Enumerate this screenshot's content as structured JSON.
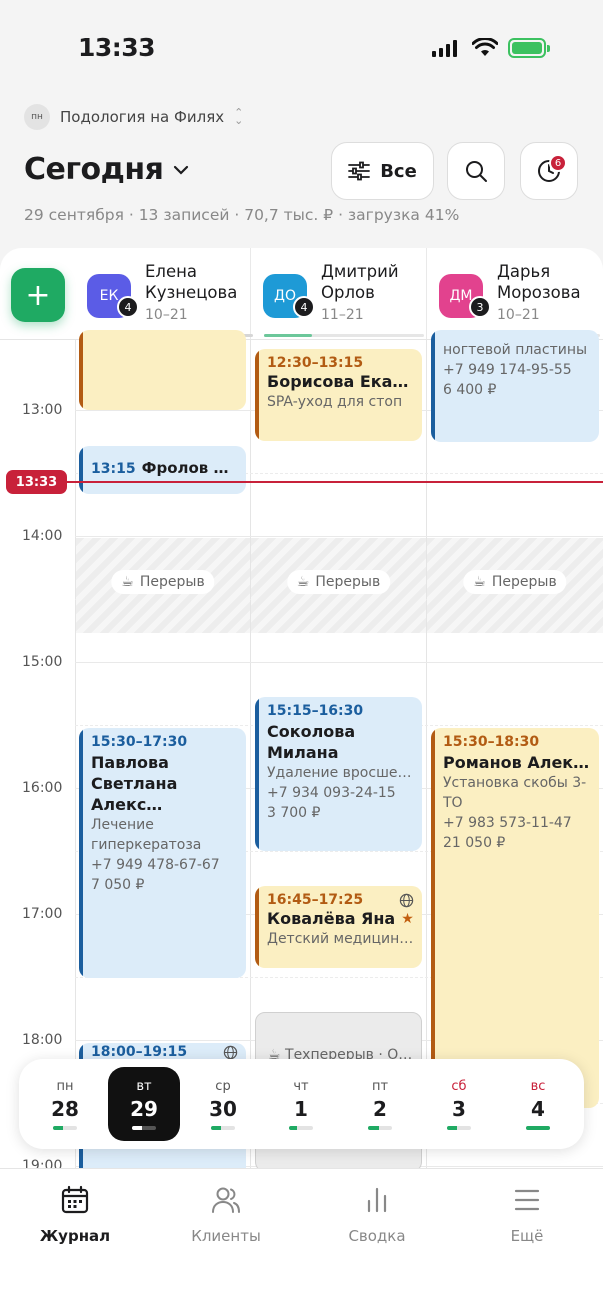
{
  "status_bar": {
    "time": "13:33"
  },
  "branch": {
    "badge": "пн",
    "name": "Подология на Филях"
  },
  "header": {
    "title": "Сегодня",
    "summary": "29 сентября · 13 записей · 70,7 тыс. ₽ · загрузка 41%",
    "filter_label": "Все",
    "notifications_count": "6"
  },
  "staff": [
    {
      "initials": "ЕК",
      "count": "4",
      "first_name": "Елена",
      "last_name": "Кузнецова",
      "hours": "10–21",
      "color": "#5b5ce6"
    },
    {
      "initials": "ДО",
      "count": "4",
      "first_name": "Дмитрий",
      "last_name": "Орлов",
      "hours": "11–21",
      "color": "#1e9ad6"
    },
    {
      "initials": "ДМ",
      "count": "3",
      "first_name": "Дарья",
      "last_name": "Морозова",
      "hours": "10–21",
      "color": "#e2428e"
    }
  ],
  "timeline": {
    "hours": [
      "13:00",
      "14:00",
      "15:00",
      "16:00",
      "17:00",
      "18:00",
      "19:00"
    ],
    "now": "13:33",
    "break_label": "Перерыв"
  },
  "appointments": {
    "a2": {
      "time": "12:30–13:15",
      "client": "Борисова Екате…",
      "service": "SPA-уход для стоп"
    },
    "a3": {
      "line1": "ногтевой пластины",
      "phone": "+7 949 174-95-55",
      "price": "6 400 ₽"
    },
    "a4": {
      "time": "13:15",
      "client": "Фролов Ив…"
    },
    "a5": {
      "time": "15:15–16:30",
      "client": "Соколова Милана",
      "service": "Удаление вросше…",
      "phone": "+7 934 093-24-15",
      "price": "3 700 ₽"
    },
    "a6": {
      "time": "15:30–17:30",
      "client": "Павлова Светлана Алекс…",
      "service": "Лечение гиперкератоза",
      "phone": "+7 949 478-67-67",
      "price": "7 050 ₽"
    },
    "a7": {
      "time": "15:30–18:30",
      "client": "Романов Алексей",
      "service": "Установка скобы 3-ТО",
      "phone": "+7 983 573-11-47",
      "price": "21 050 ₽"
    },
    "a8": {
      "time": "16:45–17:25",
      "client": "Ковалёва Яна",
      "service": "Детский медицинс…"
    },
    "a9": {
      "time": "18:00–19:15"
    },
    "a10": {
      "label": "Техперерыв · Об…"
    }
  },
  "week": [
    {
      "name": "пн",
      "num": "28",
      "load": 0.4
    },
    {
      "name": "вт",
      "num": "29",
      "load": 0.41
    },
    {
      "name": "ср",
      "num": "30",
      "load": 0.4
    },
    {
      "name": "чт",
      "num": "1",
      "load": 0.35
    },
    {
      "name": "пт",
      "num": "2",
      "load": 0.45
    },
    {
      "name": "сб",
      "num": "3",
      "load": 0.4
    },
    {
      "name": "вс",
      "num": "4",
      "load": 1.0
    }
  ],
  "tabs": [
    "Журнал",
    "Клиенты",
    "Сводка",
    "Ещё"
  ]
}
